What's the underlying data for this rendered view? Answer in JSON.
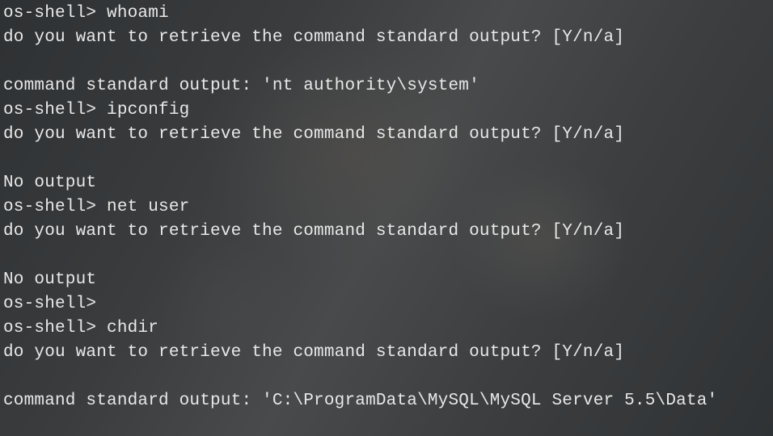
{
  "prompt": "os-shell>",
  "retrieve_prompt": "do you want to retrieve the command standard output? [Y/n/a]",
  "no_output": "No output",
  "std_out_label": "command standard output:",
  "lines": [
    {
      "type": "cmd",
      "command": "whoami"
    },
    {
      "type": "retrieve"
    },
    {
      "type": "blank"
    },
    {
      "type": "stdout",
      "value": "'nt authority\\system'"
    },
    {
      "type": "cmd",
      "command": "ipconfig"
    },
    {
      "type": "retrieve"
    },
    {
      "type": "blank"
    },
    {
      "type": "noout"
    },
    {
      "type": "cmd",
      "command": "net user"
    },
    {
      "type": "retrieve"
    },
    {
      "type": "blank"
    },
    {
      "type": "noout"
    },
    {
      "type": "cmd",
      "command": ""
    },
    {
      "type": "cmd",
      "command": "chdir"
    },
    {
      "type": "retrieve"
    },
    {
      "type": "blank"
    },
    {
      "type": "stdout",
      "value": "'C:\\ProgramData\\MySQL\\MySQL Server 5.5\\Data'"
    }
  ]
}
